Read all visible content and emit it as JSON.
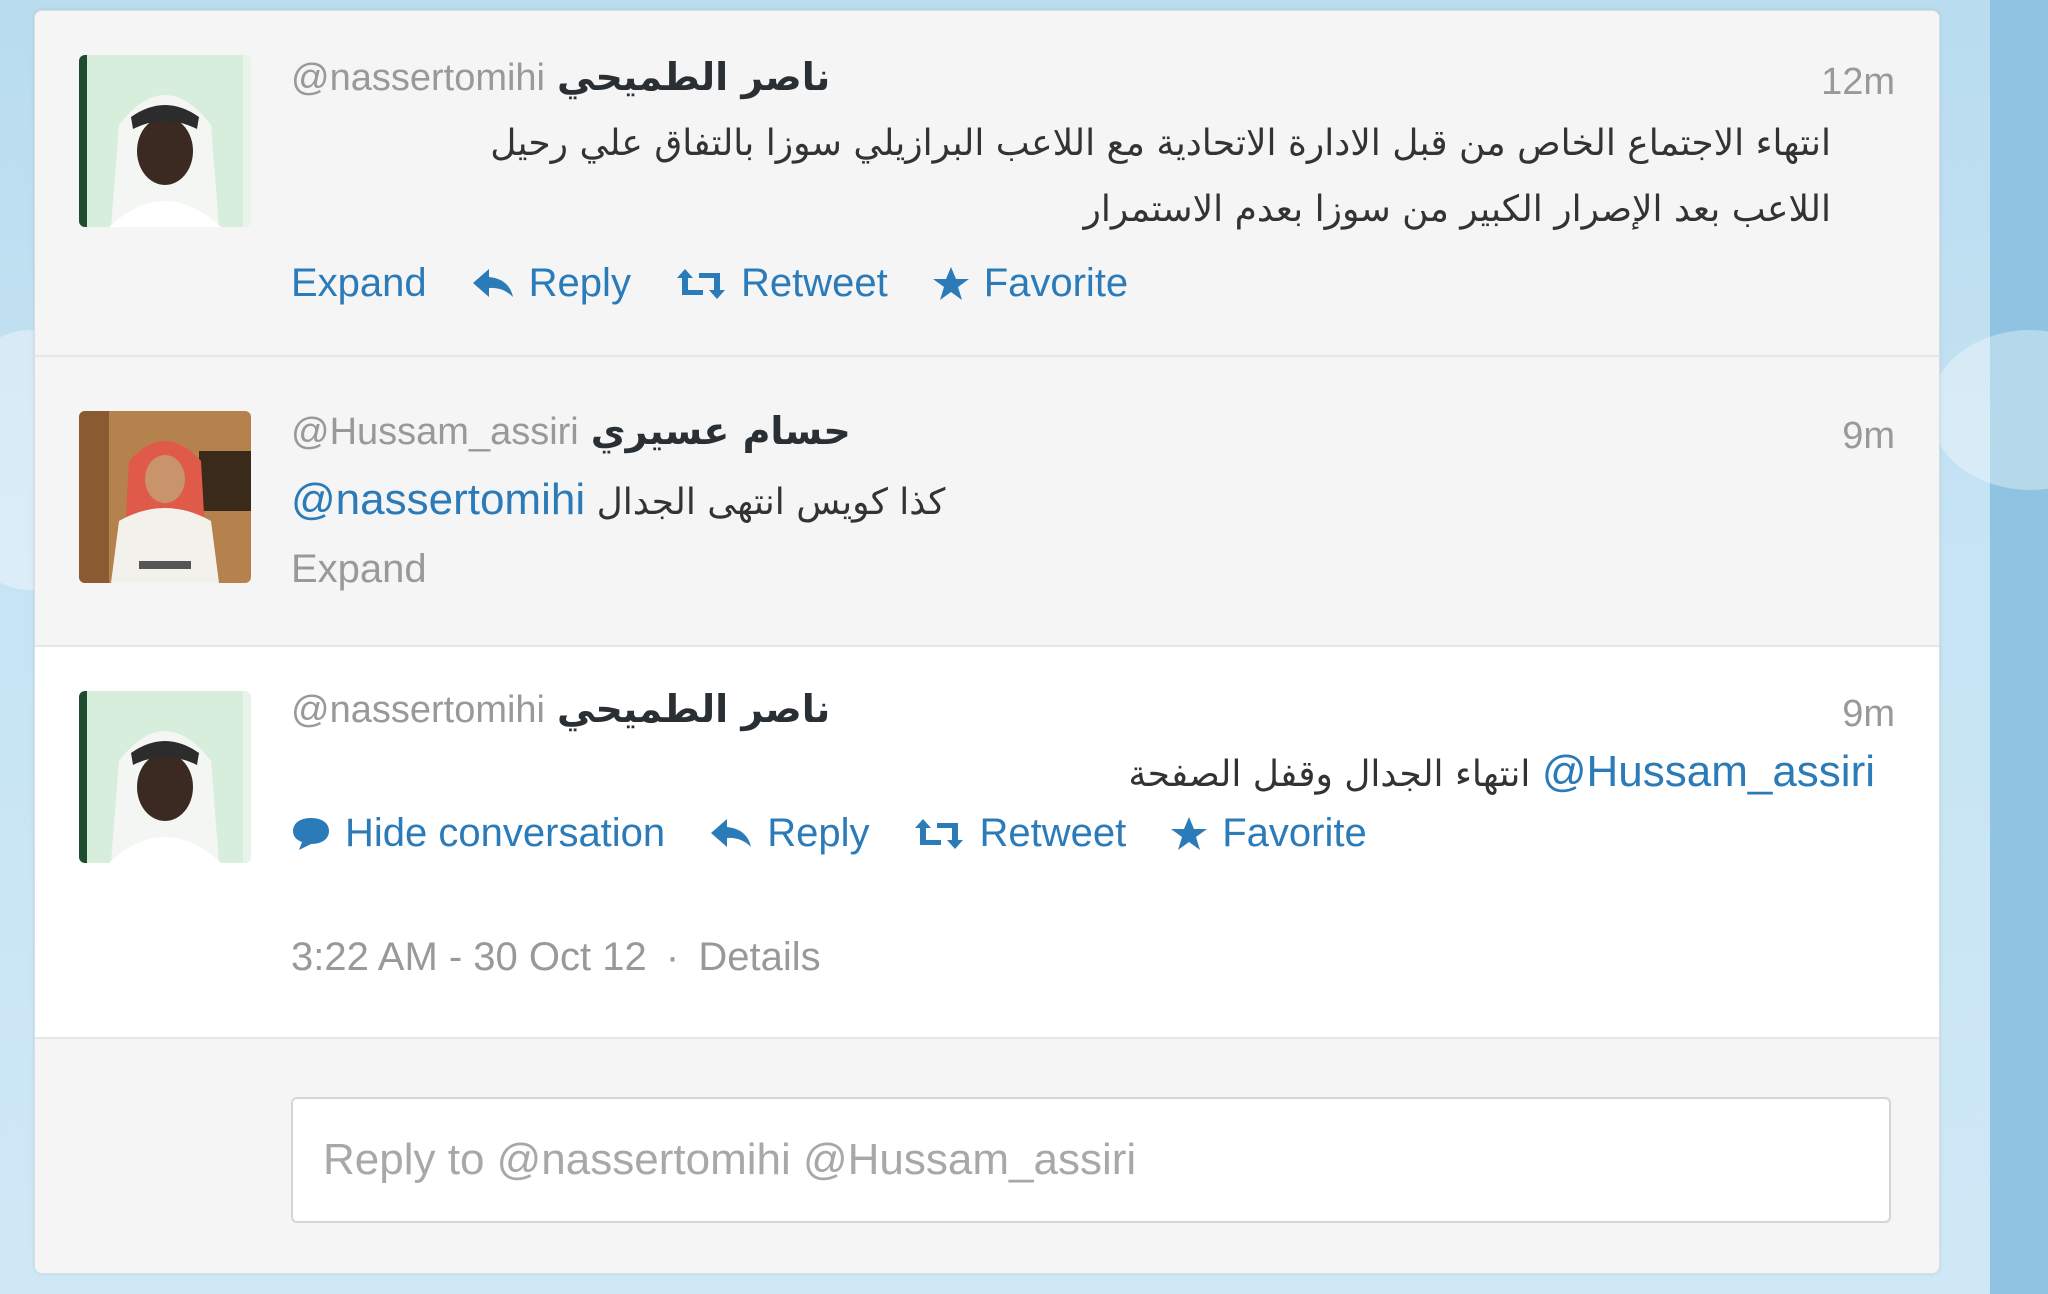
{
  "colors": {
    "link": "#2b7bb9",
    "muted": "#999999",
    "text": "#333333",
    "background": "#c6e4f4"
  },
  "tweets": [
    {
      "fullname": "ناصر الطميحي",
      "screenname": "@nassertomihi",
      "time": "12m",
      "text_line1": "انتهاء الاجتماع الخاص من قبل الادارة الاتحادية مع اللاعب البرازيلي سوزا بالتفاق علي رحيل",
      "text_line2": "اللاعب بعد الإصرار الكبير من سوزا بعدم الاستمرار",
      "actions": {
        "expand": "Expand",
        "reply": "Reply",
        "retweet": "Retweet",
        "favorite": "Favorite"
      }
    },
    {
      "fullname": "حسام عسيري",
      "screenname": "@Hussam_assiri",
      "time": "9m",
      "mention": "@nassertomihi",
      "text": "كذا كويس انتهى الجدال",
      "expand": "Expand"
    },
    {
      "fullname": "ناصر الطميحي",
      "screenname": "@nassertomihi",
      "time": "9m",
      "mention": "@Hussam_assiri",
      "text": "انتهاء الجدال وقفل الصفحة",
      "actions": {
        "hide": "Hide conversation",
        "reply": "Reply",
        "retweet": "Retweet",
        "favorite": "Favorite"
      },
      "timestamp": "3:22 AM - 30 Oct 12",
      "separator": "·",
      "details": "Details"
    }
  ],
  "reply_box": {
    "placeholder": "Reply to @nassertomihi @Hussam_assiri"
  }
}
